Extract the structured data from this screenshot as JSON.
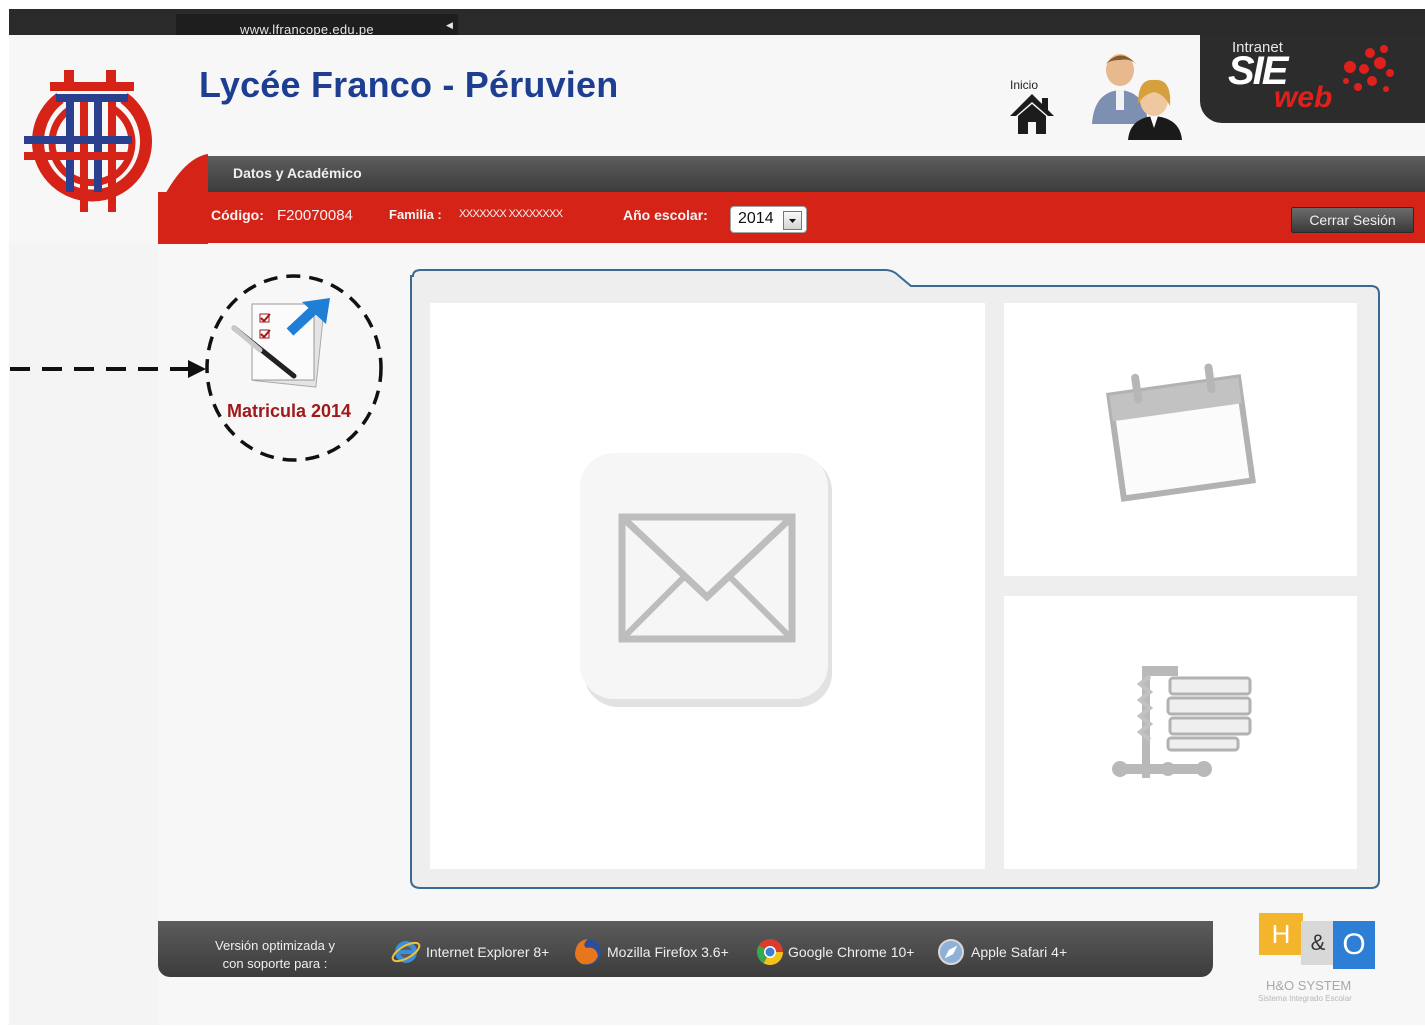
{
  "header": {
    "url": "www.lfrancope.edu.pe",
    "school_name": "Lycée Franco - Péruvien",
    "inicio_label": "Inicio",
    "sie_logo": {
      "intranet": "Intranet",
      "sie": "SIE",
      "web": "web"
    }
  },
  "nav": {
    "section_label": "Datos y Académico"
  },
  "info_bar": {
    "codigo_label": "Código:",
    "codigo_value": "F20070084",
    "familia_label": "Familia :",
    "familia_value": "XXXXXXX XXXXXXXX",
    "anio_label": "Año escolar:",
    "anio_value": "2014",
    "logout_label": "Cerrar Sesión"
  },
  "sidebar": {
    "matricula_label": "Matricula 2014"
  },
  "footer": {
    "note_line1": "Versión optimizada y",
    "note_line2": "con soporte para :",
    "browsers": [
      "Internet Explorer 8+",
      "Mozilla Firefox 3.6+",
      "Google Chrome 10+",
      "Apple Safari 4+"
    ]
  },
  "vendor": {
    "logo_h": "H",
    "logo_amp": "&",
    "logo_o": "O",
    "name": "H&O SYSTEM",
    "tagline": "Sistema Integrado Escolar"
  },
  "colors": {
    "brand_blue": "#1e3f91",
    "band_red": "#d52318",
    "matricula_red": "#a0191b",
    "dark_gray": "#3c3c3c"
  }
}
